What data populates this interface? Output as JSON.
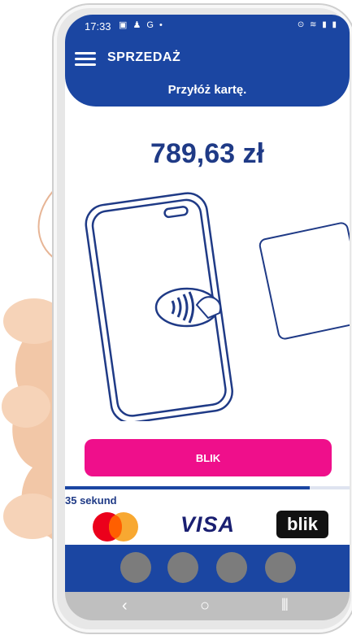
{
  "status_bar": {
    "time": "17:33",
    "left_icons": "▣ ♟ G •",
    "right_icons": "⊙ ≋ ▮ ▮"
  },
  "header": {
    "title": "SPRZEDAŻ",
    "subtitle": "Przyłóż kartę."
  },
  "payment": {
    "amount": "789,63 zł"
  },
  "actions": {
    "blik_label": "BLIK"
  },
  "timer": {
    "text": "35 sekund",
    "progress_fraction": 0.86
  },
  "logos": {
    "visa": "VISA",
    "blik": "blik"
  },
  "nav": {
    "back": "‹",
    "home": "○",
    "recent": "⦀"
  },
  "colors": {
    "brand_blue": "#1b46a2",
    "blik_pink": "#ef0f8b",
    "amount_text": "#1f3a86"
  }
}
